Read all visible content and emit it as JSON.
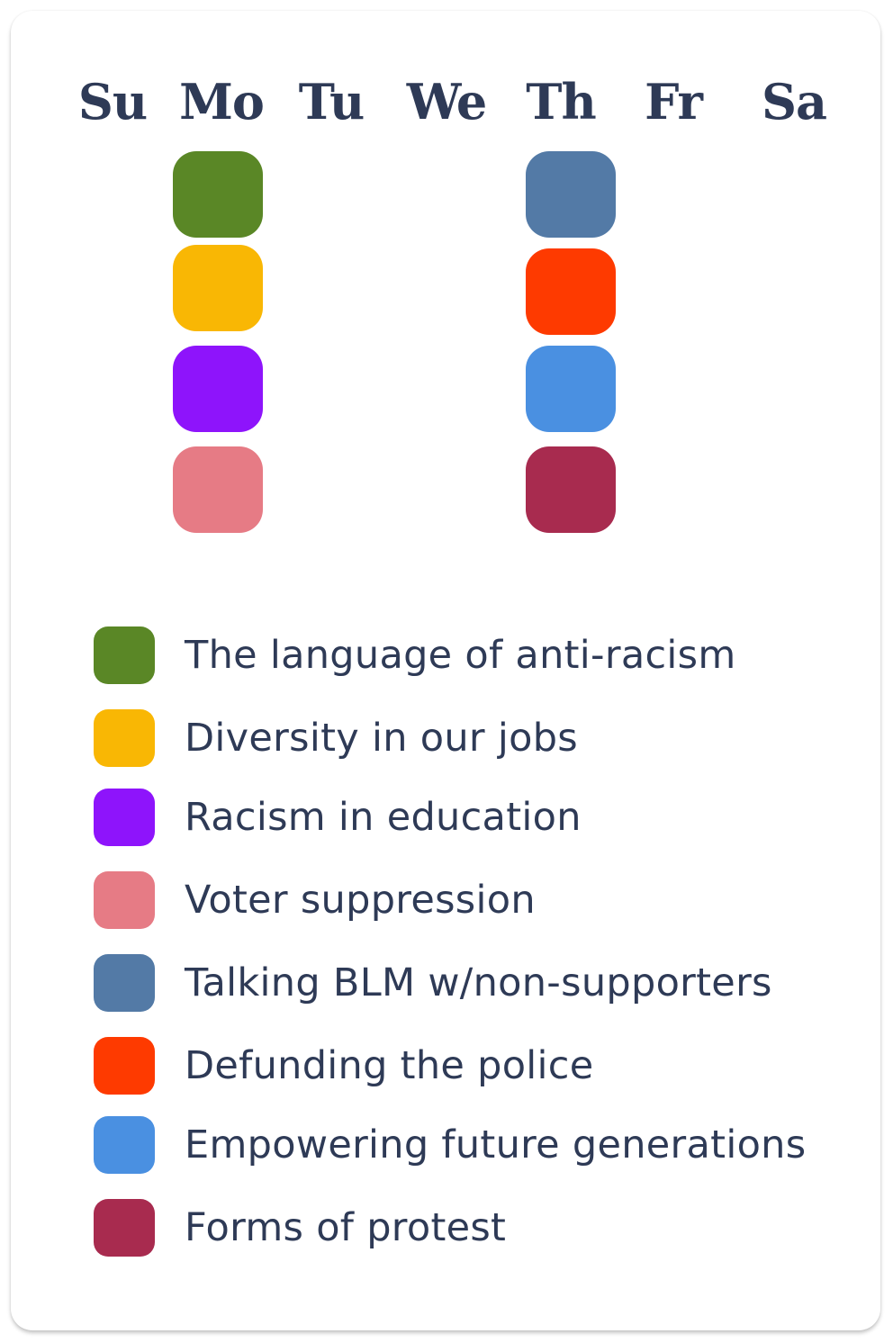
{
  "calendar": {
    "days": [
      "Su",
      "Mo",
      "Tu",
      "We",
      "Th",
      "Fr",
      "Sa"
    ],
    "columns": {
      "Mo": [
        "anti_racism_language",
        "diversity_jobs",
        "racism_education",
        "voter_suppression"
      ],
      "Th": [
        "talking_blm",
        "defunding_police",
        "empowering_future",
        "forms_of_protest"
      ]
    }
  },
  "colors": {
    "anti_racism_language": "#5a8726",
    "diversity_jobs": "#f9b704",
    "racism_education": "#8e14fb",
    "voter_suppression": "#e67b85",
    "talking_blm": "#537aa6",
    "defunding_police": "#fe3a00",
    "empowering_future": "#4a90e1",
    "forms_of_protest": "#a82b4f",
    "text": "#2e3a56"
  },
  "legend": [
    {
      "key": "anti_racism_language",
      "label": "The language of anti-racism"
    },
    {
      "key": "diversity_jobs",
      "label": "Diversity in our jobs"
    },
    {
      "key": "racism_education",
      "label": "Racism in education"
    },
    {
      "key": "voter_suppression",
      "label": "Voter suppression"
    },
    {
      "key": "talking_blm",
      "label": "Talking BLM w/non-supporters"
    },
    {
      "key": "defunding_police",
      "label": "Defunding the police"
    },
    {
      "key": "empowering_future",
      "label": "Empowering future generations"
    },
    {
      "key": "forms_of_protest",
      "label": "Forms of protest"
    }
  ]
}
